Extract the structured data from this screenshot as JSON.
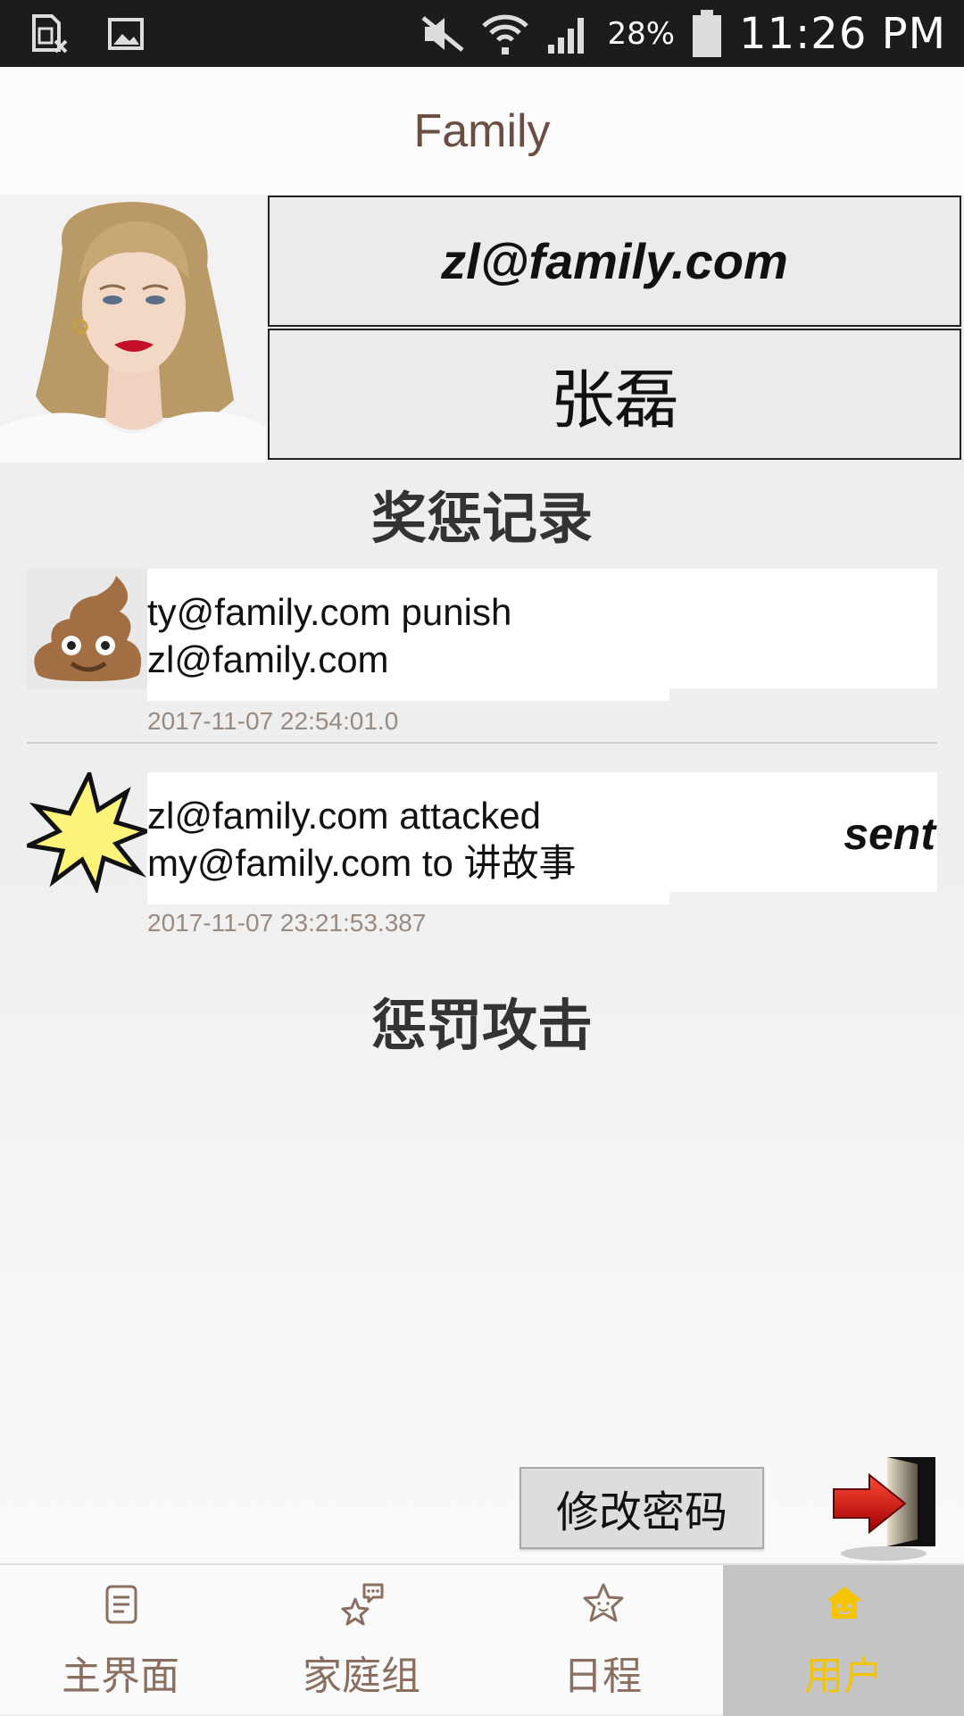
{
  "status_bar": {
    "battery_percent": "28%",
    "time": "11:26 PM",
    "icons": [
      "sim-off-icon",
      "image-icon",
      "mute-icon",
      "wifi-icon",
      "signal-icon",
      "battery-icon"
    ]
  },
  "header": {
    "title": "Family"
  },
  "profile": {
    "email": "zl@family.com",
    "name": "张磊"
  },
  "records_section": {
    "title": "奖惩记录",
    "items": [
      {
        "icon": "poop-icon",
        "message": "ty@family.com punish zl@family.com",
        "status": "",
        "time": "2017-11-07 22:54:01.0"
      },
      {
        "icon": "explosion-icon",
        "message": "zl@family.com attacked my@family.com to 讲故事",
        "status": "sent",
        "time": "2017-11-07 23:21:53.387"
      }
    ]
  },
  "attack_section": {
    "title": "惩罚攻击"
  },
  "actions": {
    "change_password": "修改密码"
  },
  "nav": {
    "items": [
      {
        "label": "主界面",
        "icon": "document-icon",
        "active": false
      },
      {
        "label": "家庭组",
        "icon": "star-chat-icon",
        "active": false
      },
      {
        "label": "日程",
        "icon": "star-face-icon",
        "active": false
      },
      {
        "label": "用户",
        "icon": "house-user-icon",
        "active": true
      }
    ]
  },
  "colors": {
    "nav_active_text": "#f5c400",
    "nav_text": "#8a6e60",
    "title_text": "#6a4e42",
    "nav_active_bg": "#c4c4c4"
  }
}
